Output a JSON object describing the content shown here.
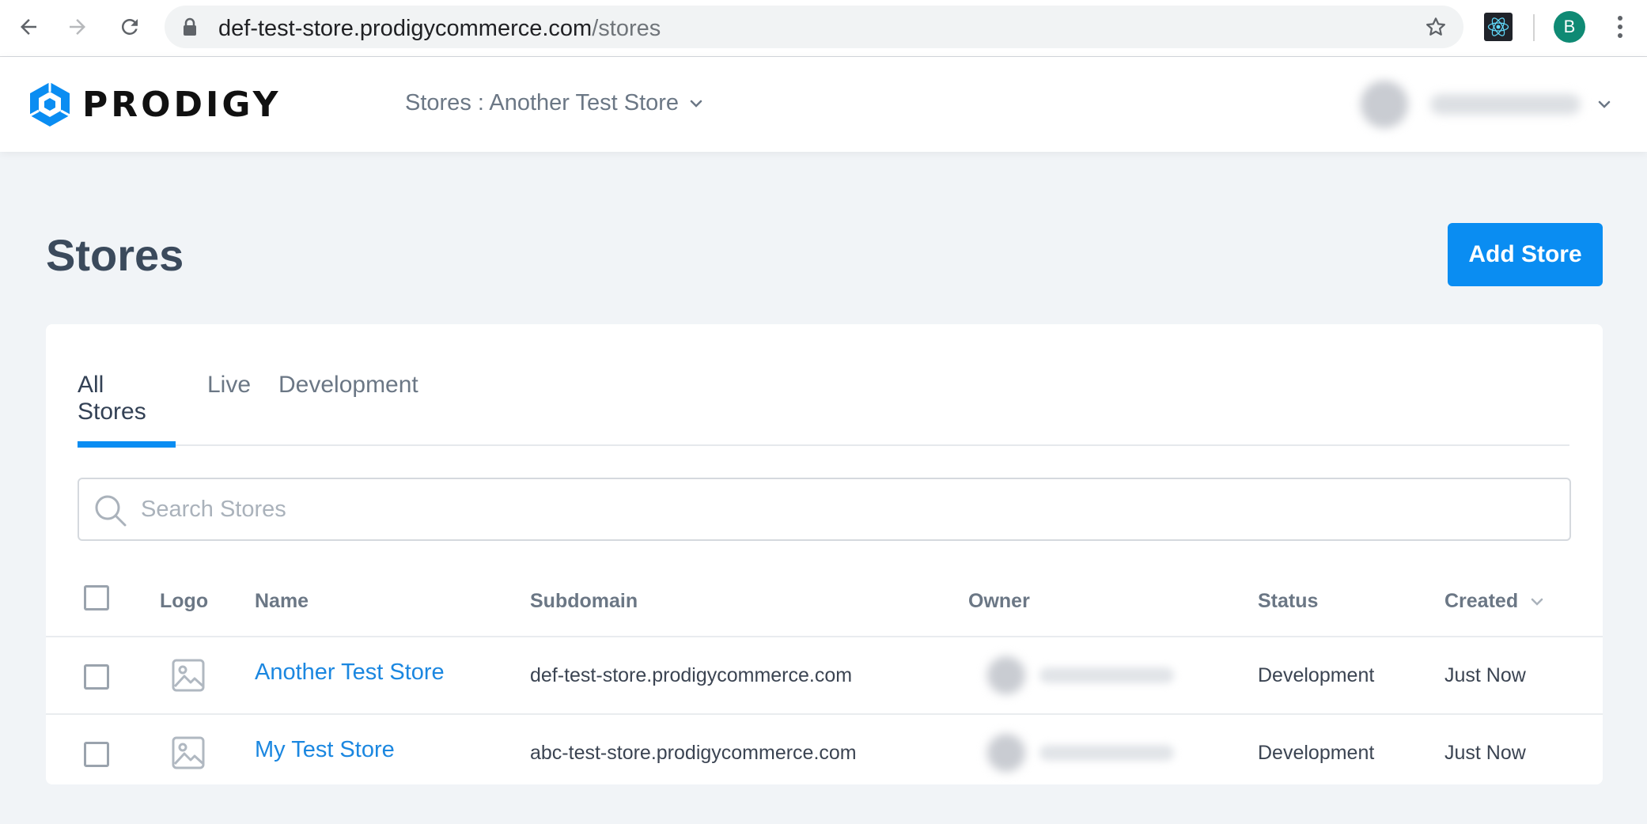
{
  "browser": {
    "url_host": "def-test-store.prodigycommerce.com",
    "url_path": "/stores",
    "profile_initial": "B",
    "icons": [
      "back-arrow-icon",
      "forward-arrow-icon",
      "reload-icon",
      "lock-icon",
      "bookmark-star-icon",
      "react-devtools-icon",
      "kebab-menu-icon"
    ]
  },
  "header": {
    "logo_text": "PRODIGY",
    "store_switcher": "Stores : Another Test Store",
    "brand_color": "#0a8df2"
  },
  "page": {
    "title": "Stores",
    "add_button": "Add Store"
  },
  "tabs": [
    {
      "label": "All Stores",
      "active": true
    },
    {
      "label": "Live",
      "active": false
    },
    {
      "label": "Development",
      "active": false
    }
  ],
  "search": {
    "placeholder": "Search Stores",
    "value": ""
  },
  "table": {
    "columns": [
      "Logo",
      "Name",
      "Subdomain",
      "Owner",
      "Status",
      "Created"
    ],
    "sort_column": "Created",
    "rows": [
      {
        "name": "Another Test Store",
        "subdomain": "def-test-store.prodigycommerce.com",
        "status": "Development",
        "created": "Just Now"
      },
      {
        "name": "My Test Store",
        "subdomain": "abc-test-store.prodigycommerce.com",
        "status": "Development",
        "created": "Just Now"
      }
    ]
  }
}
